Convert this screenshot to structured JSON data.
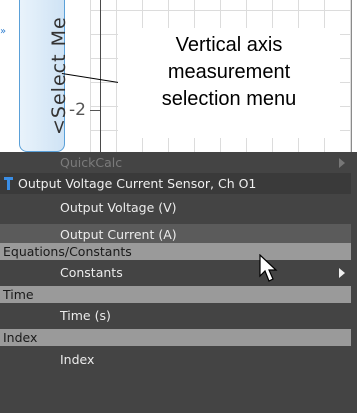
{
  "graph": {
    "y_tick_label": "-2",
    "axis_button_label": "<Select Me",
    "edge_marker": "»",
    "callout": {
      "line1": "Vertical axis",
      "line2": "measurement",
      "line3": "selection menu"
    }
  },
  "menu": {
    "quickcalc": "QuickCalc",
    "sensor_header": "Output Voltage Current Sensor, Ch O1",
    "items_sensor": [
      "Output Voltage (V)",
      "Output Current (A)"
    ],
    "section_equations": "Equations/Constants",
    "constants": "Constants",
    "section_time": "Time",
    "time_item": "Time (s)",
    "section_index": "Index",
    "index_item": "Index"
  },
  "colors": {
    "menu_bg": "#444444",
    "section_bg": "#9a9a9a",
    "highlight_bg": "#5b5b5b",
    "axis_button_border": "#5aa0d8"
  }
}
